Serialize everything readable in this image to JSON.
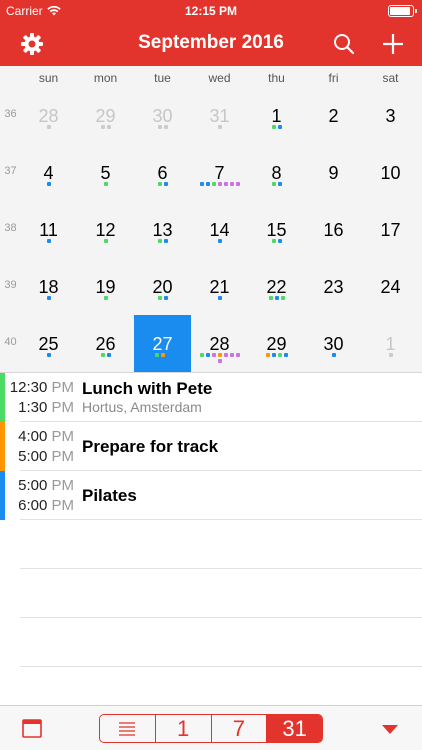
{
  "status": {
    "carrier": "Carrier",
    "time": "12:15 PM",
    "battery_level": 0.95
  },
  "header": {
    "title": "September 2016",
    "left_icon": "gear-icon",
    "right_icons": [
      "search-icon",
      "plus-icon"
    ]
  },
  "weekdays": [
    "sun",
    "mon",
    "tue",
    "wed",
    "thu",
    "fri",
    "sat"
  ],
  "weeks": [
    {
      "number": "36",
      "days": [
        {
          "label": "28",
          "other": true,
          "dots": [
            "#cccccc"
          ]
        },
        {
          "label": "29",
          "other": true,
          "dots": [
            "#cccccc",
            "#cccccc"
          ]
        },
        {
          "label": "30",
          "other": true,
          "dots": [
            "#cccccc",
            "#cccccc"
          ]
        },
        {
          "label": "31",
          "other": true,
          "dots": [
            "#cccccc"
          ]
        },
        {
          "label": "1",
          "other": false,
          "dots": [
            "#4cd964",
            "#1a8cf0"
          ]
        },
        {
          "label": "2",
          "other": false,
          "dots": []
        },
        {
          "label": "3",
          "other": false,
          "dots": []
        }
      ]
    },
    {
      "number": "37",
      "days": [
        {
          "label": "4",
          "other": false,
          "dots": [
            "#1a8cf0"
          ]
        },
        {
          "label": "5",
          "other": false,
          "dots": [
            "#4cd964"
          ]
        },
        {
          "label": "6",
          "other": false,
          "dots": [
            "#4cd964",
            "#1a8cf0"
          ]
        },
        {
          "label": "7",
          "other": false,
          "dots": [
            "#1a8cf0",
            "#1a8cf0",
            "#4cd964",
            "#cc73e1",
            "#cc73e1",
            "#cc73e1",
            "#cc73e1"
          ]
        },
        {
          "label": "8",
          "other": false,
          "dots": [
            "#4cd964",
            "#1a8cf0"
          ]
        },
        {
          "label": "9",
          "other": false,
          "dots": []
        },
        {
          "label": "10",
          "other": false,
          "dots": []
        }
      ]
    },
    {
      "number": "38",
      "days": [
        {
          "label": "11",
          "other": false,
          "dots": [
            "#1a8cf0"
          ]
        },
        {
          "label": "12",
          "other": false,
          "dots": [
            "#4cd964"
          ]
        },
        {
          "label": "13",
          "other": false,
          "dots": [
            "#4cd964",
            "#1a8cf0"
          ]
        },
        {
          "label": "14",
          "other": false,
          "dots": [
            "#1a8cf0"
          ]
        },
        {
          "label": "15",
          "other": false,
          "dots": [
            "#4cd964",
            "#1a8cf0"
          ]
        },
        {
          "label": "16",
          "other": false,
          "dots": []
        },
        {
          "label": "17",
          "other": false,
          "dots": []
        }
      ]
    },
    {
      "number": "39",
      "days": [
        {
          "label": "18",
          "other": false,
          "dots": [
            "#1a8cf0"
          ]
        },
        {
          "label": "19",
          "other": false,
          "dots": [
            "#4cd964"
          ]
        },
        {
          "label": "20",
          "other": false,
          "dots": [
            "#4cd964",
            "#1a8cf0"
          ]
        },
        {
          "label": "21",
          "other": false,
          "dots": [
            "#1a8cf0"
          ]
        },
        {
          "label": "22",
          "other": false,
          "dots": [
            "#4cd964",
            "#1a8cf0",
            "#4cd964"
          ]
        },
        {
          "label": "23",
          "other": false,
          "dots": []
        },
        {
          "label": "24",
          "other": false,
          "dots": []
        }
      ]
    },
    {
      "number": "40",
      "days": [
        {
          "label": "25",
          "other": false,
          "dots": [
            "#1a8cf0"
          ]
        },
        {
          "label": "26",
          "other": false,
          "dots": [
            "#4cd964",
            "#1a8cf0"
          ]
        },
        {
          "label": "27",
          "other": false,
          "selected": true,
          "dots": [
            "#4cd964",
            "#ff9500",
            "#1a8cf0"
          ]
        },
        {
          "label": "28",
          "other": false,
          "dots": [
            "#4cd964",
            "#1a8cf0",
            "#cc73e1",
            "#ff9500",
            "#cc73e1",
            "#cc73e1",
            "#cc73e1",
            "#cc73e1"
          ]
        },
        {
          "label": "29",
          "other": false,
          "dots": [
            "#ff9500",
            "#1a8cf0",
            "#4cd964",
            "#1a8cf0"
          ]
        },
        {
          "label": "30",
          "other": false,
          "dots": [
            "#1a8cf0"
          ]
        },
        {
          "label": "1",
          "other": true,
          "dots": [
            "#cccccc"
          ]
        }
      ]
    }
  ],
  "events": [
    {
      "start": "12:30",
      "start_ampm": "PM",
      "end": "1:30",
      "end_ampm": "PM",
      "title": "Lunch with Pete",
      "location": "Hortus, Amsterdam",
      "color": "#4cd964"
    },
    {
      "start": "4:00",
      "start_ampm": "PM",
      "end": "5:00",
      "end_ampm": "PM",
      "title": "Prepare for track",
      "location": "",
      "color": "#ff9500"
    },
    {
      "start": "5:00",
      "start_ampm": "PM",
      "end": "6:00",
      "end_ampm": "PM",
      "title": "Pilates",
      "location": "",
      "color": "#1a8cf0"
    }
  ],
  "toolbar": {
    "left_icon": "calendar-icon",
    "segments": [
      {
        "name": "list",
        "label": "",
        "icon": "list-icon"
      },
      {
        "name": "day",
        "label": "1"
      },
      {
        "name": "week",
        "label": "7"
      },
      {
        "name": "month",
        "label": "31",
        "active": true
      }
    ],
    "right_icon": "triangle-down-icon"
  },
  "colors": {
    "accent": "#e3332d",
    "selected_day": "#1a8cf0"
  }
}
